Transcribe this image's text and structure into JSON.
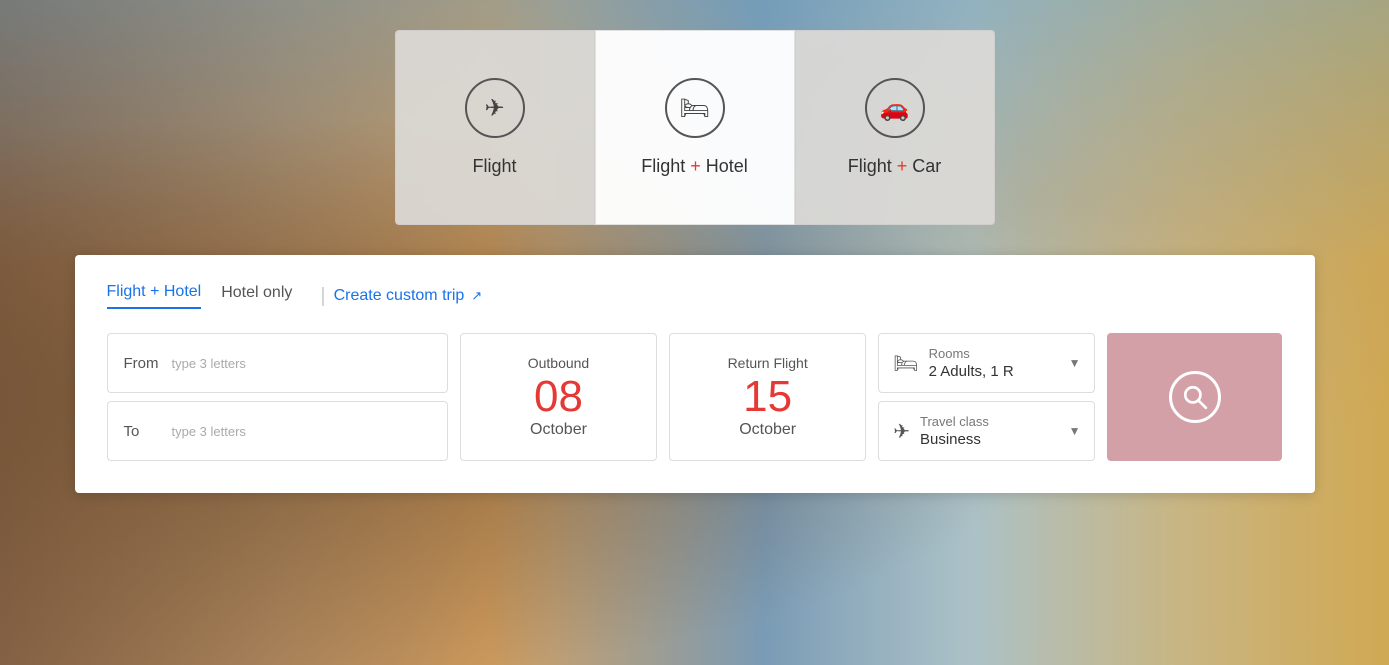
{
  "tabs": [
    {
      "id": "flight",
      "icon": "✈",
      "label": "Flight",
      "plus": false,
      "active": false
    },
    {
      "id": "flight-hotel",
      "icon": "🛏",
      "label_before": "Flight ",
      "plus": "+",
      "label_after": " Hotel",
      "active": true
    },
    {
      "id": "flight-car",
      "icon": "🚗",
      "label_before": "Flight ",
      "plus": "+",
      "label_after": " Car",
      "active": false
    }
  ],
  "sub_tabs": [
    {
      "id": "flight-hotel-tab",
      "label": "Flight + Hotel",
      "active": true
    },
    {
      "id": "hotel-only-tab",
      "label": "Hotel only",
      "active": false
    }
  ],
  "custom_trip": {
    "label": "Create custom trip",
    "icon": "↗"
  },
  "from_field": {
    "label": "From",
    "placeholder": "type 3 letters"
  },
  "to_field": {
    "label": "To",
    "placeholder": "type 3 letters"
  },
  "outbound": {
    "label": "Outbound",
    "day": "08",
    "month": "October"
  },
  "return_flight": {
    "label": "Return Flight",
    "day": "15",
    "month": "October"
  },
  "rooms": {
    "title": "Rooms",
    "value": "2 Adults, 1 R"
  },
  "travel_class": {
    "title": "Travel class",
    "value": "Business"
  },
  "search_button": {
    "aria_label": "Search"
  },
  "colors": {
    "accent_red": "#e53935",
    "accent_blue": "#1a73e8",
    "search_btn_bg": "#d4a0a8"
  }
}
